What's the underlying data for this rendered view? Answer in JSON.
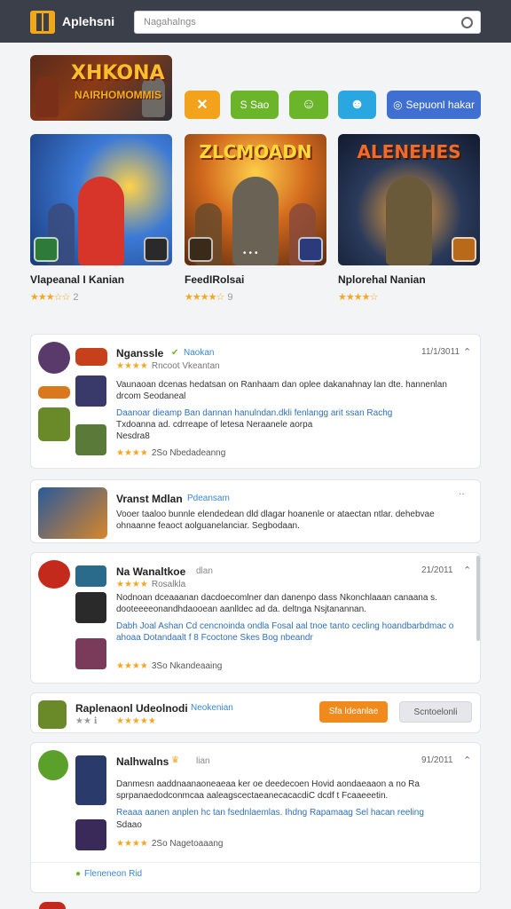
{
  "header": {
    "app_title": "Aplehsni",
    "search_placeholder": "Nagahalngs"
  },
  "hero": {
    "banner_title": "XHKONA",
    "banner_subtitle": "NAIRHOMOMMIS"
  },
  "quick_actions": [
    {
      "label": "S Sao",
      "icon": "gift-icon",
      "color": "#6bb52a"
    },
    {
      "label": "Sepuonl hakar",
      "icon": "chat-icon",
      "color": "#3f6fd1"
    }
  ],
  "games": [
    {
      "name": "Vlapeanal I Kanian",
      "rating_stars": "★★★☆☆",
      "rating_count": "2",
      "art_title": "",
      "bg": "#2a5fb8",
      "accent": "#e23a2a"
    },
    {
      "name": "FeedIRolsai",
      "rating_stars": "★★★★☆",
      "rating_count": "9",
      "art_title": "ZLCMOADN",
      "bg": "#b85d1a",
      "accent": "#7a5a3a"
    },
    {
      "name": "Nplorehal Nanian",
      "rating_stars": "★★★★☆",
      "rating_count": "",
      "art_title": "ALENEHES",
      "bg": "#1d2c4a",
      "accent": "#6a5a3a"
    }
  ],
  "reviews": [
    {
      "name": "Nganssle",
      "tag": "Naokan",
      "stars": "★★★★",
      "subtag": "Rncoot Vkeantan",
      "date": "11/1/3011",
      "text": "Vaunaoan dcenas hedatsan on Ranhaam dan oplee dakanahnay lan dte. hannenlan drcom Seodaneal",
      "link": "Daanoar dieamp Ban dannan hanulndan.dkli fenlangg arit ssan Rachg",
      "more": "Txdoanna  ad. cdrreape of letesa Neraanele aorpa",
      "hashtags": "Nesdra8",
      "foot_stars": "★★★★",
      "foot": "2So  Nbedadeanng"
    },
    {
      "name": "Vranst Mdlan",
      "tag": "Pdeansam",
      "text": "Vooer taaloo bunnle elendedean dld dlagar hoanenle or ataectan ntlar. dehebvae ohnaanne feaoct aolguanelanciar. Segbodaan.",
      "date": "··"
    },
    {
      "name": "Na Wanaltkoe",
      "tag": "dlan",
      "stars": "★★★★",
      "subtag": "Rosalkla",
      "date": "21/2011",
      "text": "Nodnoan dceaaanan dacdoecomlner dan danenpo dass Nkonchlaaan canaana s. dooteeeeonandhdaooean aanlldec ad da. deltnga Nsjtanannan.",
      "link": "Dabh Joal Ashan  Cd cencnoinda ondla Fosal  aal tnoe tanto cecling hoandbarbdmac o ahoaa Dotandaalt f 8 Fcoctone Skes Bog nbeandr",
      "foot_stars": "★★★★",
      "foot": "3So  Nkandeaaing"
    }
  ],
  "promo": {
    "name": "Raplenaonl Udeolnodi",
    "tag": "Neokenian",
    "stars": "★★★★★",
    "rating_prefix": "★★ ℹ",
    "primary_label": "Sfa ldeanlae",
    "secondary_label": "Scntoelonli"
  },
  "last_review": {
    "name": "Nalhwalns",
    "tag": "lian",
    "date": "91/2011",
    "text": "Danmesn aaddnaanaoneaeaa ker oe deedecoen Hovid aondaeaaon a no Ra sprpanaedodconmcaa aaleagscectaeanecacacdiC dcdf t Fcaaeeetin.",
    "link": "Reaaa aanen anplen hc tan fsednlaemlas. Ihdng Rapamaag Sel hacan reeling",
    "more": "Sdaao",
    "foot_stars": "★★★★",
    "foot": "2So  Nagetoaaang",
    "meta": "Fleneneon  Rid"
  },
  "colors": {
    "topbar": "#3b3f4a",
    "accent_orange": "#f08a1c",
    "star": "#f5a623",
    "link": "#2f6fb5"
  }
}
